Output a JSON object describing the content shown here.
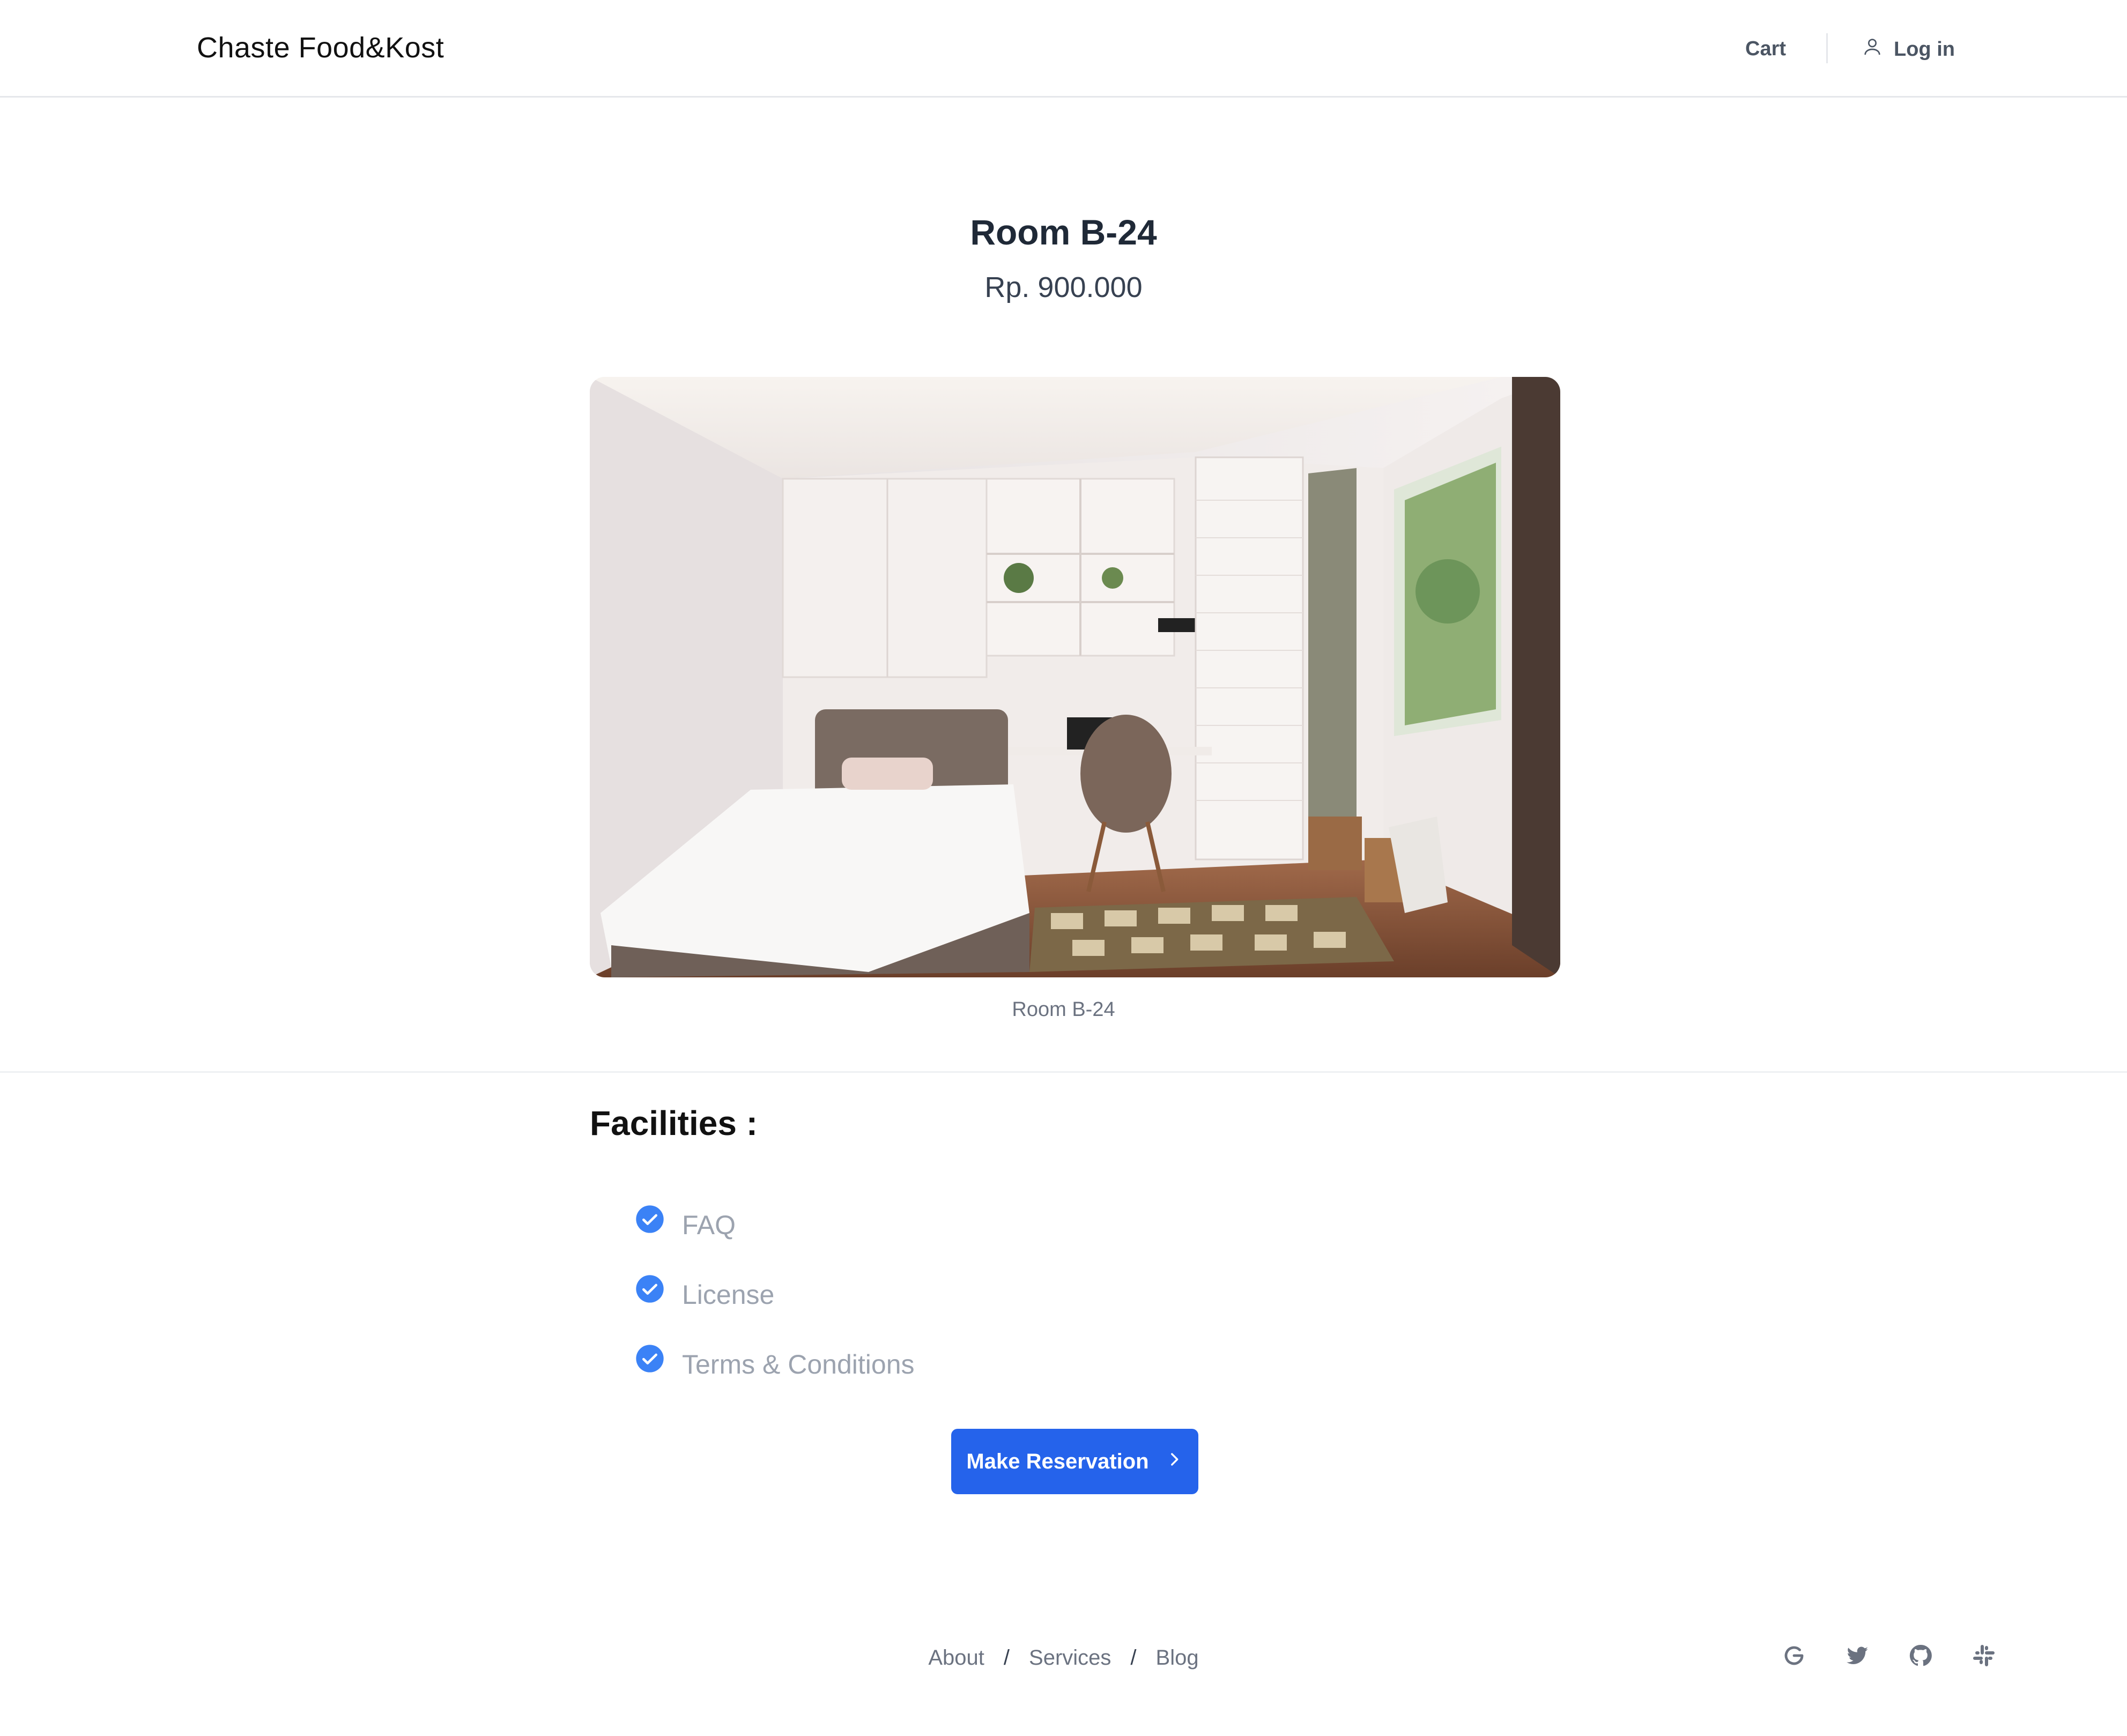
{
  "header": {
    "brand": "Chaste Food&Kost",
    "cart_label": "Cart",
    "login_label": "Log in",
    "login_icon": "user-icon"
  },
  "room": {
    "title": "Room B-24",
    "price": "Rp. 900.000",
    "caption": "Room B-24"
  },
  "facilities": {
    "heading": "Facilities :",
    "items": [
      {
        "label": "FAQ",
        "icon": "check-circle-icon"
      },
      {
        "label": "License",
        "icon": "check-circle-icon"
      },
      {
        "label": "Terms & Conditions",
        "icon": "check-circle-icon"
      }
    ]
  },
  "reserve": {
    "label": "Make Reservation",
    "icon": "chevron-right-icon"
  },
  "footer": {
    "links": [
      "About",
      "Services",
      "Blog"
    ],
    "separator": "/",
    "socials": [
      "google-icon",
      "twitter-icon",
      "github-icon",
      "slack-icon"
    ]
  },
  "colors": {
    "accent": "#2563eb",
    "text_dark": "#1f2937",
    "text_muted": "#9ca3af"
  }
}
